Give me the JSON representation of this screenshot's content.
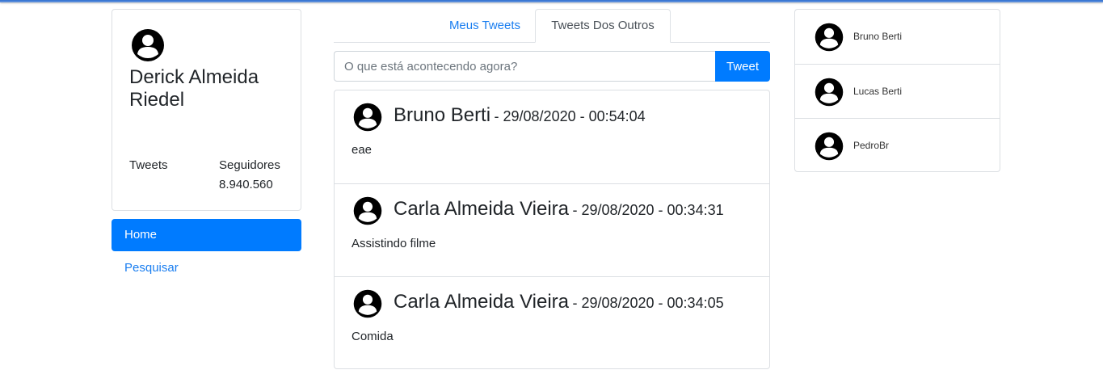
{
  "profile": {
    "name": "Derick Almeida Riedel",
    "tweets_label": "Tweets",
    "followers_label": "Seguidores",
    "followers_count": "8.940.560",
    "avatar_icon": "user-circle-icon"
  },
  "nav": {
    "home": "Home",
    "search": "Pesquisar"
  },
  "tabs": {
    "mine": "Meus Tweets",
    "others": "Tweets Dos Outros",
    "active": "others"
  },
  "compose": {
    "placeholder": "O que está acontecendo agora?",
    "button": "Tweet"
  },
  "feed": [
    {
      "author": "Bruno Berti",
      "date": "29/08/2020 - 00:54:04",
      "text": "eae"
    },
    {
      "author": "Carla Almeida Vieira",
      "date": "29/08/2020 - 00:34:31",
      "text": "Assistindo filme"
    },
    {
      "author": "Carla Almeida Vieira",
      "date": "29/08/2020 - 00:34:05",
      "text": "Comida"
    }
  ],
  "separator": "-",
  "follow_list": [
    {
      "name": "Bruno Berti"
    },
    {
      "name": "Lucas Berti"
    },
    {
      "name": "PedroBr"
    }
  ],
  "colors": {
    "primary": "#007bff",
    "link": "#1a7ef0",
    "border": "#dcdfe3",
    "text": "#212529"
  }
}
